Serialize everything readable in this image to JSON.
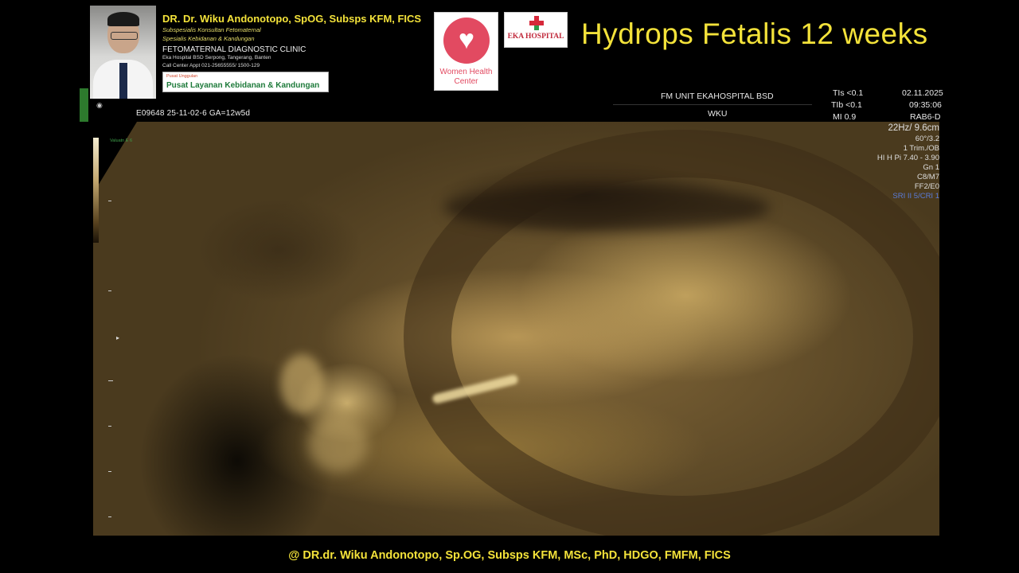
{
  "header": {
    "doctor_name": "DR. Dr. Wiku Andonotopo, SpOG, Subsps KFM, FICS",
    "subtitle_1": "Subspesialis Konsultan Fetomaternal",
    "subtitle_2": "Spesialis Kebidanan & Kandungan",
    "clinic": "FETOMATERNAL DIAGNOSTIC CLINIC",
    "address": "Eka Hospital BSD Serpong, Tangerang, Banten",
    "phone": "Call Center Appt 021-25655555/ 1500-129",
    "badge_small": "Pusat Unggulan",
    "badge_main": "Pusat Layanan Kebidanan & Kandungan",
    "whc_label": "Women Health Center",
    "eka_label": "EKA HOSPITAL",
    "title": "Hydrops Fetalis 12 weeks"
  },
  "ultrasound": {
    "unit": "FM UNIT EKAHOSPITAL BSD",
    "operator": "WKU",
    "tis": "TIs <0.1",
    "tib": "TIb <0.1",
    "mi": "MI  0.9",
    "date": "02.11.2025",
    "time": "09:35:06",
    "probe": "RAB6-D",
    "patient_line": "E09648  25-11-02-6  GA=12w5d",
    "colorbar_label": "Valuatn E 6",
    "params": [
      "22Hz/ 9.6cm",
      "60°/3.2",
      "1 Trim./OB",
      "HI H Pi 7.40 - 3.90",
      "Gn  1",
      "C8/M7",
      "FF2/E0",
      "SRI II 5/CRI 1"
    ]
  },
  "footer": "@ DR.dr. Wiku Andonotopo, Sp.OG, Subsps KFM, MSc, PhD, HDGO, FMFM, FICS",
  "colors": {
    "title_yellow": "#f3e23a",
    "background": "#000000",
    "scan_sepia": "#7d6336",
    "badge_green": "#1d7a3a",
    "whc_pink": "#e24a61",
    "eka_red": "#c0283a"
  }
}
